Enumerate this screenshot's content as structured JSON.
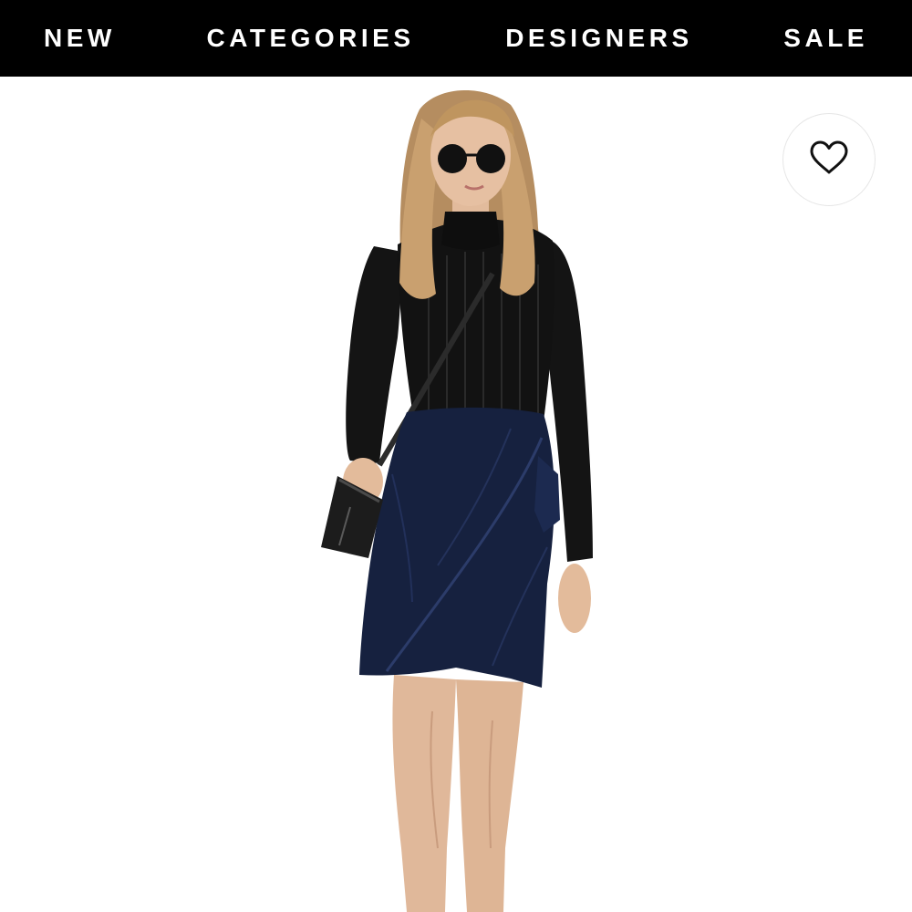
{
  "nav": {
    "items": [
      {
        "label": "NEW"
      },
      {
        "label": "CATEGORIES"
      },
      {
        "label": "DESIGNERS"
      },
      {
        "label": "SALE"
      }
    ]
  },
  "product": {
    "image_icon": "product-photo",
    "wishlist_icon": "heart-outline-icon"
  },
  "colors": {
    "nav_background": "#000000",
    "nav_text": "#ffffff",
    "page_background": "#ffffff",
    "sweater": "#121212",
    "skirt": "#16213f"
  }
}
